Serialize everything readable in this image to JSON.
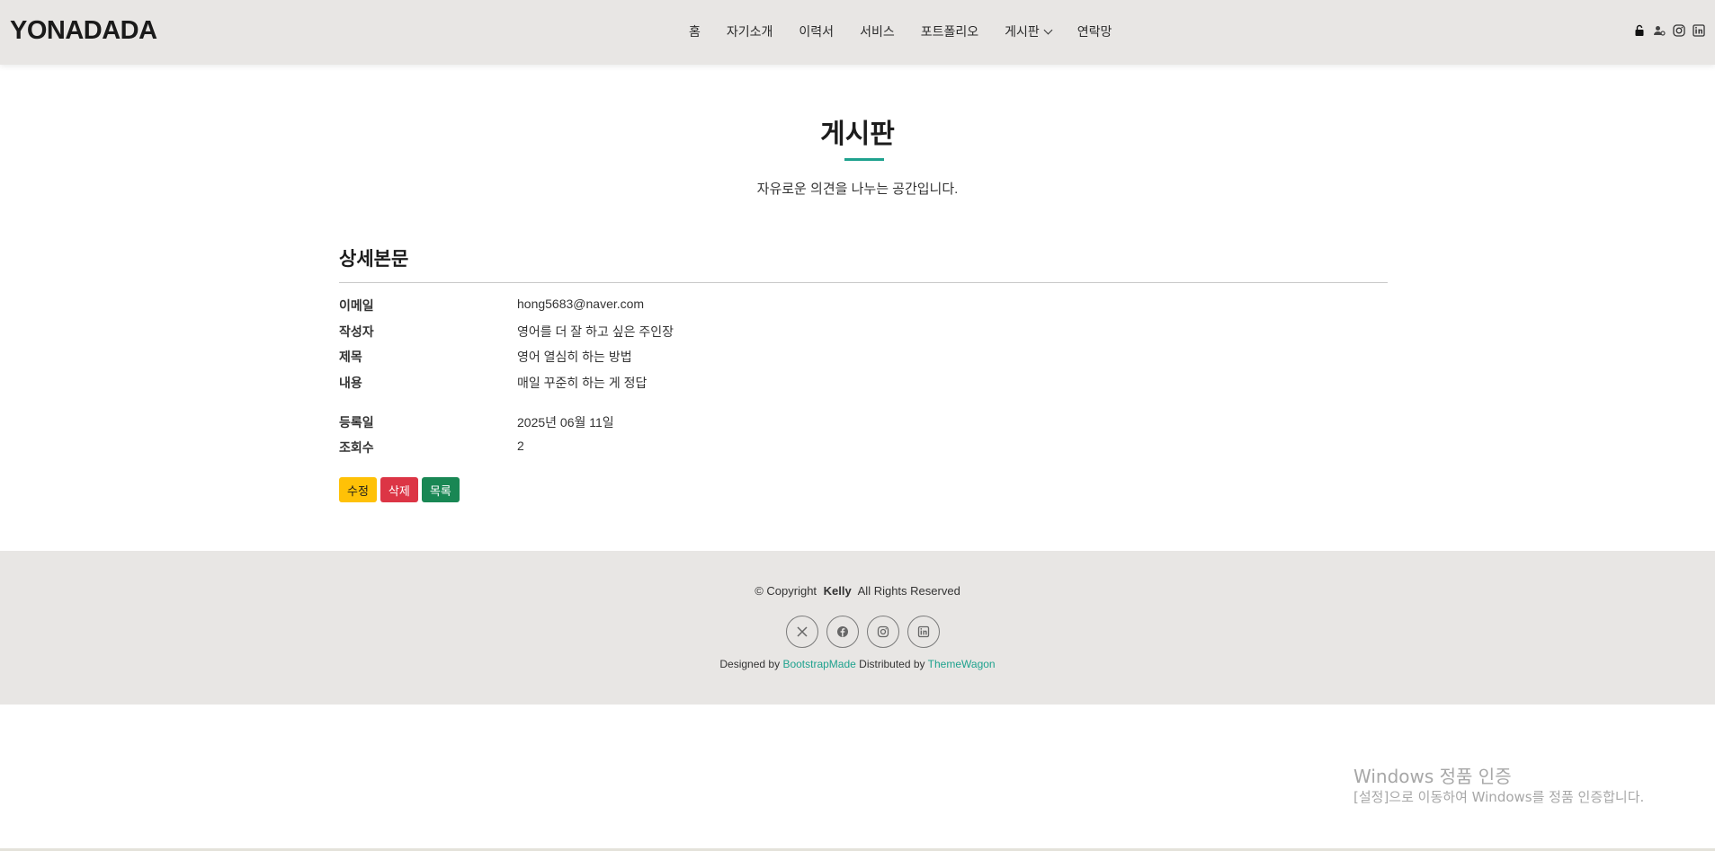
{
  "header": {
    "logo": "YONADADA",
    "nav": [
      {
        "label": "홈"
      },
      {
        "label": "자기소개"
      },
      {
        "label": "이력서"
      },
      {
        "label": "서비스"
      },
      {
        "label": "포트폴리오"
      },
      {
        "label": "게시판"
      },
      {
        "label": "연락망"
      }
    ],
    "icons": [
      "unlock-icon",
      "user-settings-icon",
      "instagram-icon",
      "linkedin-icon"
    ]
  },
  "page": {
    "title": "게시판",
    "subtitle": "자유로운 의견을 나누는 공간입니다.",
    "accent_color": "#1fa28e"
  },
  "detail": {
    "section_title": "상세본문",
    "fields": [
      {
        "key": "이메일",
        "value": "hong5683@naver.com"
      },
      {
        "key": "작성자",
        "value": "영어를 더 잘 하고 싶은 주인장"
      },
      {
        "key": "제목",
        "value": "영어 열심히 하는 방법"
      },
      {
        "key": "내용",
        "value": "매일 꾸준히 하는 게 정답"
      },
      {
        "key": "등록일",
        "value": "2025년 06월 11일"
      },
      {
        "key": "조회수",
        "value": "2"
      }
    ],
    "buttons": {
      "edit": "수정",
      "delete": "삭제",
      "list": "목록"
    }
  },
  "footer": {
    "copyright_prefix": "© Copyright",
    "copyright_name": "Kelly",
    "copyright_suffix": "All Rights Reserved",
    "social": [
      "x-icon",
      "facebook-icon",
      "instagram-icon",
      "linkedin-icon"
    ],
    "designed_by": "Designed by",
    "bootstrapmade": "BootstrapMade",
    "distributed_by": "Distributed by",
    "themewagon": "ThemeWagon"
  },
  "watermark": {
    "line1": "Windows 정품 인증",
    "line2": "[설정]으로 이동하여 Windows를 정품 인증합니다."
  }
}
